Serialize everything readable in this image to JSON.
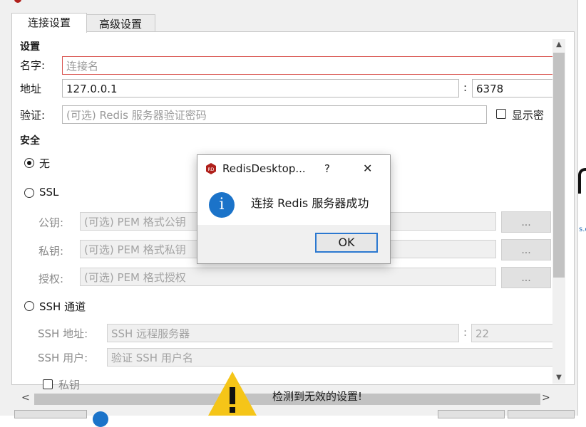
{
  "tabs": [
    {
      "label": "连接设置"
    },
    {
      "label": "高级设置"
    }
  ],
  "settings": {
    "section_label": "设置",
    "name_label": "名字:",
    "name_placeholder": "连接名",
    "address_label": "地址",
    "address_value": "127.0.0.1",
    "port_sep": ":",
    "port_value": "6378",
    "auth_label": "验证:",
    "auth_placeholder": "(可选) Redis 服务器验证密码",
    "show_password_label": "显示密"
  },
  "security": {
    "section_label": "安全",
    "none_label": "无",
    "ssl_label": "SSL",
    "public_key_label": "公钥:",
    "public_key_placeholder": "(可选) PEM 格式公钥",
    "private_key_label": "私钥:",
    "private_key_placeholder": "(可选) PEM 格式私钥",
    "auth_label": "授权:",
    "auth_placeholder": "(可选) PEM 格式授权",
    "browse_label": "...",
    "ssh_label": "SSH 通道",
    "ssh_address_label": "SSH 地址:",
    "ssh_address_placeholder": "SSH 远程服务器",
    "ssh_port_sep": ":",
    "ssh_port_value": "22",
    "ssh_user_label": "SSH 用户:",
    "ssh_user_placeholder": "验证 SSH 用户名",
    "private_key_checkbox_label": "私钥"
  },
  "scroll": {
    "up": "▲",
    "down": "▼",
    "left": "<",
    "right": ">"
  },
  "warning": {
    "text": "检测到无效的设置!"
  },
  "dialog": {
    "title": "RedisDesktop...",
    "help": "?",
    "close": "✕",
    "message": "连接 Redis 服务器成功",
    "ok_label": "OK"
  },
  "colors": {
    "accent": "#2b78d0",
    "error_border": "#d9534f",
    "info_icon": "#1b73c9",
    "warning": "#f5c518",
    "redis_red": "#b0201b"
  },
  "icons": {
    "dialog_app": "redis-icon",
    "dialog_info": "info-icon",
    "warning": "warning-icon"
  }
}
